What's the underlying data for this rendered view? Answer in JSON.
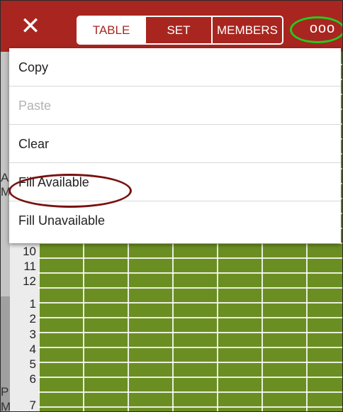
{
  "header": {
    "close_icon": "close-icon",
    "tabs": [
      {
        "label": "TABLE",
        "active": true
      },
      {
        "label": "SET",
        "active": false
      },
      {
        "label": "MEMBERS",
        "active": false
      }
    ],
    "more_label": "ooo",
    "bar_color": "#a8261f"
  },
  "menu": {
    "items": [
      {
        "label": "Copy",
        "enabled": true
      },
      {
        "label": "Paste",
        "enabled": false
      },
      {
        "label": "Clear",
        "enabled": true
      },
      {
        "label": "Fill Available",
        "enabled": true
      },
      {
        "label": "Fill Unavailable",
        "enabled": true
      }
    ]
  },
  "grid": {
    "hours": [
      "10",
      "11",
      "12",
      "1",
      "2",
      "3",
      "4",
      "5",
      "6",
      "7"
    ],
    "am_label_partial": [
      "A",
      "M"
    ],
    "pm_label": [
      "P",
      "M"
    ],
    "cell_color": "#6b8e23"
  },
  "annotations": {
    "green_circle_color": "#22cc22",
    "red_circle_color": "#7a1010"
  }
}
